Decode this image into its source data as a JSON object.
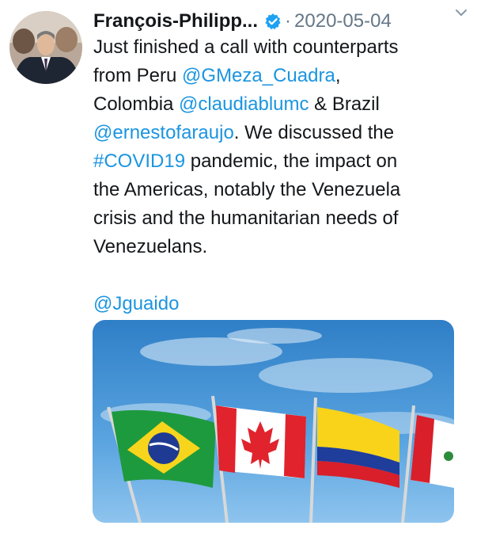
{
  "tweet": {
    "author": "François-Philipp...",
    "separator": "·",
    "date": "2020-05-04",
    "verified_icon": "verified-badge-icon",
    "more_icon": "chevron-down-icon",
    "lines": [
      [
        {
          "text": "Just finished a call with counterparts"
        }
      ],
      [
        {
          "text": "from Peru "
        },
        {
          "text": "@GMeza_Cuadra",
          "link": true
        },
        {
          "text": ","
        }
      ],
      [
        {
          "text": "Colombia "
        },
        {
          "text": "@claudiablumc",
          "link": true
        },
        {
          "text": " & Brazil"
        }
      ],
      [
        {
          "text": "@ernestofaraujo",
          "link": true
        },
        {
          "text": ". We discussed the"
        }
      ],
      [
        {
          "text": "#COVID19",
          "link": true
        },
        {
          "text": " pandemic, the impact on"
        }
      ],
      [
        {
          "text": "the Americas, notably the Venezuela"
        }
      ],
      [
        {
          "text": "crisis and the humanitarian needs of"
        }
      ],
      [
        {
          "text": "Venezuelans."
        }
      ],
      [],
      [
        {
          "text": "@Jguaido",
          "link": true
        }
      ]
    ],
    "media": {
      "description_icon": "flags-photo",
      "flags": [
        "brazil-flag",
        "canada-flag",
        "colombia-flag",
        "peru-flag"
      ]
    }
  },
  "colors": {
    "link": "#1b95e0",
    "text": "#14171a",
    "muted": "#657786",
    "verified": "#1da1f2"
  }
}
